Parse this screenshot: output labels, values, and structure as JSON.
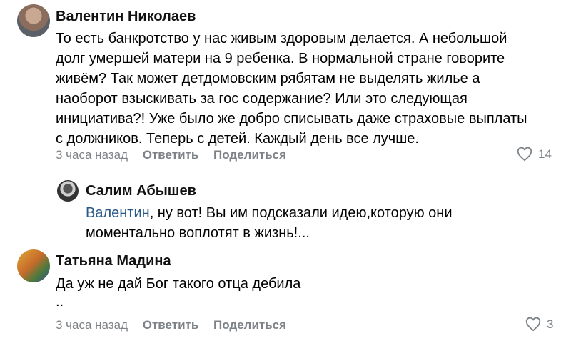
{
  "comments": [
    {
      "author": "Валентин Николаев",
      "lines": [
        "То есть банкротство у нас живым здоровым делается. А небольшой",
        "долг умершей матери на 9 ребенка. В нормальной стране говорите",
        "живём? Так может детдомовским рябятам не выделять жилье а",
        "наоборот взыскивать за гос содержание? Или это следующая",
        "инициатива?! Уже было же добро списывать даже страховые выплаты",
        "с должников. Теперь с детей. Каждый день все лучше."
      ],
      "time": "3 часа назад",
      "reply_label": "Ответить",
      "share_label": "Поделиться",
      "likes": "14"
    },
    {
      "author": "Салим Абышев",
      "mention": "Валентин",
      "line1_rest": ", ну вот! Вы им подсказали идею,которую они",
      "line2": "моментально воплотят в жизнь!..."
    },
    {
      "author": "Татьяна Мадина",
      "lines": [
        "Да уж не дай Бог такого отца дебила",
        ".."
      ],
      "time": "3 часа назад",
      "reply_label": "Ответить",
      "share_label": "Поделиться",
      "likes": "3"
    }
  ],
  "icons": {
    "like": "heart-outline-icon"
  },
  "colors": {
    "meta": "#7d8287",
    "mention": "#2a5885"
  }
}
